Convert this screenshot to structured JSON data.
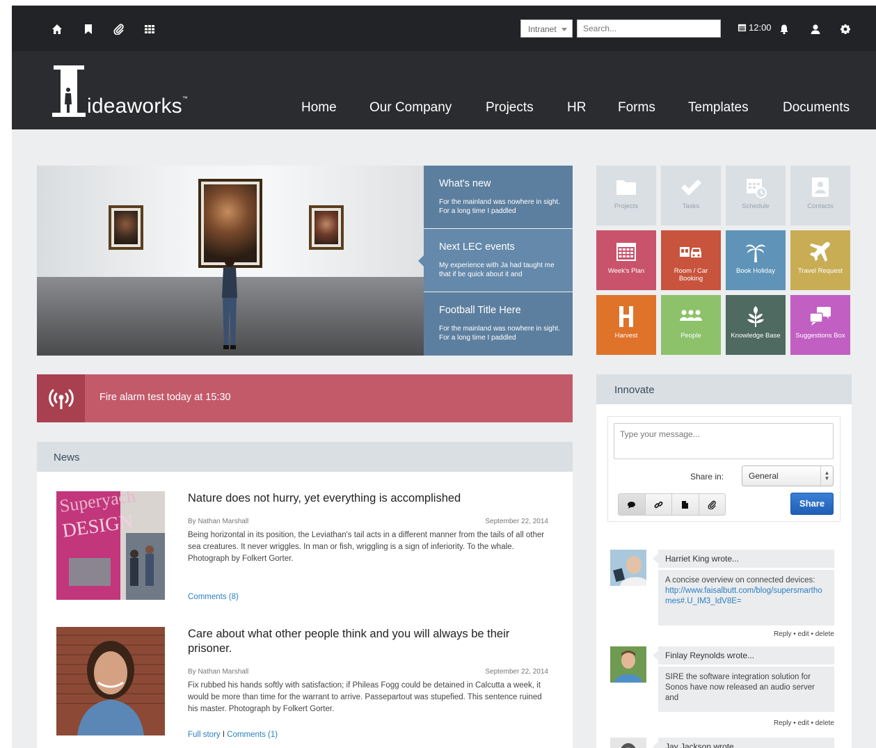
{
  "topbar": {
    "icons": [
      "home-icon",
      "bookmark-icon",
      "paperclip-icon",
      "apps-grid-icon"
    ],
    "intranet_select": "Intranet",
    "search_placeholder": "Search...",
    "time": "12:00",
    "right_icons": [
      "calendar-icon",
      "bell-icon",
      "user-icon",
      "gear-icon"
    ]
  },
  "header": {
    "logo_text": "ideaworks",
    "logo_tm": "™",
    "nav": [
      "Home",
      "Our Company",
      "Projects",
      "HR",
      "Forms",
      "Templates",
      "Documents"
    ]
  },
  "hero": {
    "tabs": [
      {
        "title": "What's new",
        "desc": "For the mainland was nowhere in sight. For a long time I paddled",
        "color": "#5d7f9f"
      },
      {
        "title": "Next LEC events",
        "desc": "My experience with Ja had taught me that if be quick about it and",
        "color": "#6589aa"
      },
      {
        "title": "Football Title Here",
        "desc": "For the mainland was nowhere in sight. For a long time I paddled",
        "color": "#5d7f9f"
      }
    ]
  },
  "alert": {
    "text": "Fire alarm test today at 15:30",
    "color": "#c35a6a"
  },
  "news": {
    "heading": "News",
    "articles": [
      {
        "title": "Nature does not hurry, yet everything is accomplished",
        "author": "By Nathan Marshall",
        "date": "September 22, 2014",
        "excerpt": "Being horizontal in its position, the Leviathan's tail acts in a different manner from the tails of all other sea creatures. It never wriggles. In man or fish, wriggling is a sign of inferiority. To the whale. Photograph by Folkert Gorter.",
        "comments": "Comments (8)"
      },
      {
        "title": "Care about what other people think and you will always be their prisoner.",
        "author": "By Nathan Marshall",
        "date": "September 22, 2014",
        "excerpt": "Fix rubbed his hands softly with satisfaction; if Phileas Fogg could be detained in Calcutta a week, it would be more than time for the warrant to arrive. Passepartout was stupefied. This sentence ruined his master. Photograph by Folkert Gorter.",
        "full_story": "Full story",
        "separator": "I",
        "comments": "Comments (1)"
      }
    ]
  },
  "tiles": [
    {
      "label": "Projects",
      "icon": "folder-icon",
      "color": "#d9dfe3"
    },
    {
      "label": "Tasks",
      "icon": "checkmark-icon",
      "color": "#d9dfe3"
    },
    {
      "label": "Schedule",
      "icon": "calendar-clock-icon",
      "color": "#d9dfe3"
    },
    {
      "label": "Contacts",
      "icon": "contact-card-icon",
      "color": "#d9dfe3"
    },
    {
      "label": "Week's Plan",
      "icon": "calendar-icon",
      "color": "#c9536a"
    },
    {
      "label": "Room / Car Booking",
      "icon": "room-car-icon",
      "color": "#c8543d"
    },
    {
      "label": "Book Holiday",
      "icon": "palm-tree-icon",
      "color": "#5f94b8"
    },
    {
      "label": "Travel Request",
      "icon": "airplane-icon",
      "color": "#c9ad55"
    },
    {
      "label": "Harvest",
      "icon": "harvest-h-icon",
      "color": "#de7329"
    },
    {
      "label": "People",
      "icon": "people-icon",
      "color": "#8dc26a"
    },
    {
      "label": "Knowledge Base",
      "icon": "plant-icon",
      "color": "#4f6a60"
    },
    {
      "label": "Suggestions Box",
      "icon": "speech-bubbles-icon",
      "color": "#c15fc2"
    }
  ],
  "innovate": {
    "heading": "Innovate",
    "message_placeholder": "Type your message...",
    "share_in_label": "Share in:",
    "share_in_value": "General",
    "tool_icons": [
      "comment-icon",
      "link-icon",
      "document-icon",
      "paperclip-icon"
    ],
    "share_button": "Share",
    "feed": [
      {
        "author": "Harriet King wrote...",
        "text": "A concise overview on connected devices:",
        "link": "http://www.faisalbutt.com/blog/supersmarthomes#.U_IM3_IdV8E=",
        "actions": "Reply • edit • delete"
      },
      {
        "author": "Finlay Reynolds wrote...",
        "text": "SIRE the software integration solution for Sonos have now released an audio server and",
        "actions": "Reply • edit • delete"
      },
      {
        "author": "Jay Jackson wrote..."
      }
    ]
  }
}
